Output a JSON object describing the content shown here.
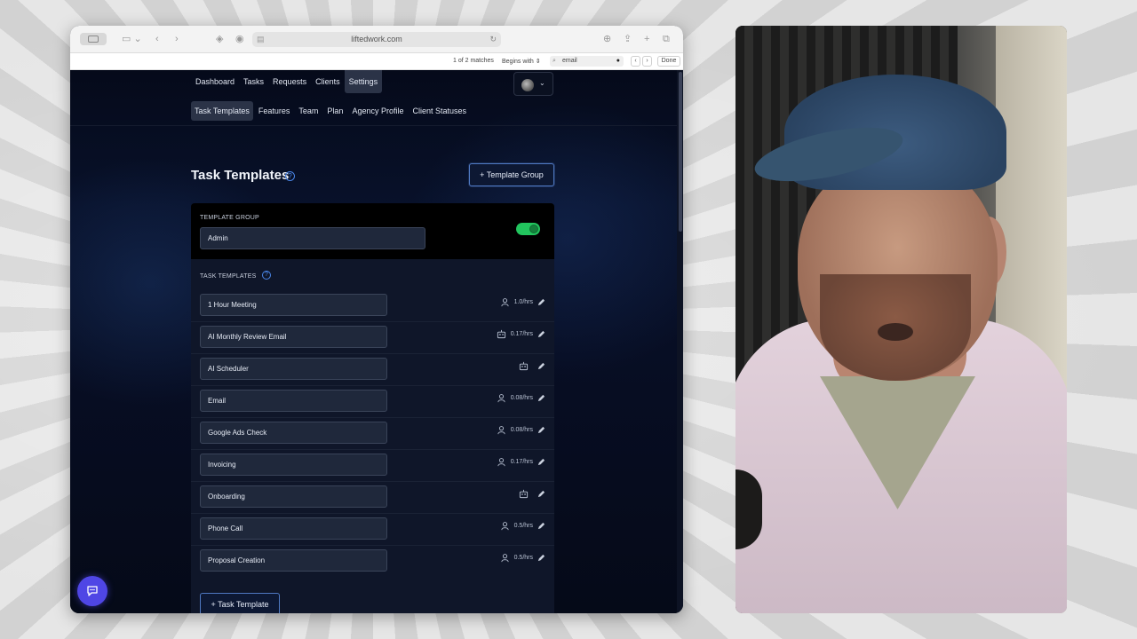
{
  "browser": {
    "url": "liftedwork.com",
    "find": {
      "count": "1 of 2 matches",
      "mode": "Begins with",
      "query": "email",
      "done": "Done"
    }
  },
  "nav": {
    "items": [
      "Dashboard",
      "Tasks",
      "Requests",
      "Clients",
      "Settings"
    ],
    "active": "Settings"
  },
  "subnav": {
    "items": [
      "Task Templates",
      "Features",
      "Team",
      "Plan",
      "Agency Profile",
      "Client Statuses"
    ],
    "active": "Task Templates"
  },
  "page": {
    "title": "Task Templates",
    "template_group_button": "Template Group"
  },
  "group": {
    "label": "TEMPLATE GROUP",
    "name": "Admin",
    "enabled": true,
    "task_templates_label": "TASK TEMPLATES"
  },
  "templates": [
    {
      "name": "1 Hour Meeting",
      "icon": "person-icon",
      "hours": "1.0/hrs"
    },
    {
      "name": "AI Monthly Review Email",
      "icon": "robot-icon",
      "hours": "0.17/hrs"
    },
    {
      "name": "AI Scheduler",
      "icon": "robot-icon",
      "hours": ""
    },
    {
      "name": "Email",
      "icon": "person-icon",
      "hours": "0.08/hrs"
    },
    {
      "name": "Google Ads Check",
      "icon": "person-icon",
      "hours": "0.08/hrs"
    },
    {
      "name": "Invoicing",
      "icon": "person-icon",
      "hours": "0.17/hrs"
    },
    {
      "name": "Onboarding",
      "icon": "robot-icon",
      "hours": ""
    },
    {
      "name": "Phone Call",
      "icon": "person-icon",
      "hours": "0.5/hrs"
    },
    {
      "name": "Proposal Creation",
      "icon": "person-icon",
      "hours": "0.5/hrs"
    }
  ],
  "add_task_template": "Task Template",
  "colors": {
    "accent": "#4a86e8",
    "toggle_on": "#22c55e",
    "chat_fab": "#4f46e5",
    "page_bg": "#070d22"
  }
}
